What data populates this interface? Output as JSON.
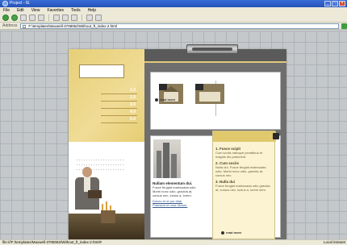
{
  "window": {
    "title": "Project - IE"
  },
  "menu": {
    "items": [
      "File",
      "Edit",
      "View",
      "Favorites",
      "Tools",
      "Help"
    ]
  },
  "address": {
    "label": "Address",
    "value": "F:\\templates\\Maxwell-3708062\\Without_ft_index-2.html"
  },
  "nav": {
    "items": [
      "1.0",
      "2.0",
      "3.0",
      "4.0",
      "5.0"
    ]
  },
  "articles": {
    "heading": "Nullam elementum dui.",
    "body": "Fusce feugiat malesuada odio. Morbi nunc odio, gravida at, cursus nec, luctus a, lorem.",
    "links": [
      "Donec et ut pur diab.",
      "Praesent id urna dictum."
    ]
  },
  "read_more": {
    "label": "read more"
  },
  "note": {
    "items": [
      {
        "title": "1. Fusce scipit",
        "text": "Cum sociis natoque penatibus et magnis dis parturient."
      },
      {
        "title": "2. Cum sociis",
        "text": "Nulla dui. Fusce feugiat malesuada odio. Morbi nunc odio, gravida at, cursus nec."
      },
      {
        "title": "3. Nulla dui",
        "text": "Fusce feugiat malesuada odio gravida at, cursus nec, luctus a, lorem sem."
      }
    ]
  },
  "status": {
    "left": "file:///F:/templates/Maxwell-3708062/Without_ft_index-2.html#",
    "right": "Local intranet"
  }
}
